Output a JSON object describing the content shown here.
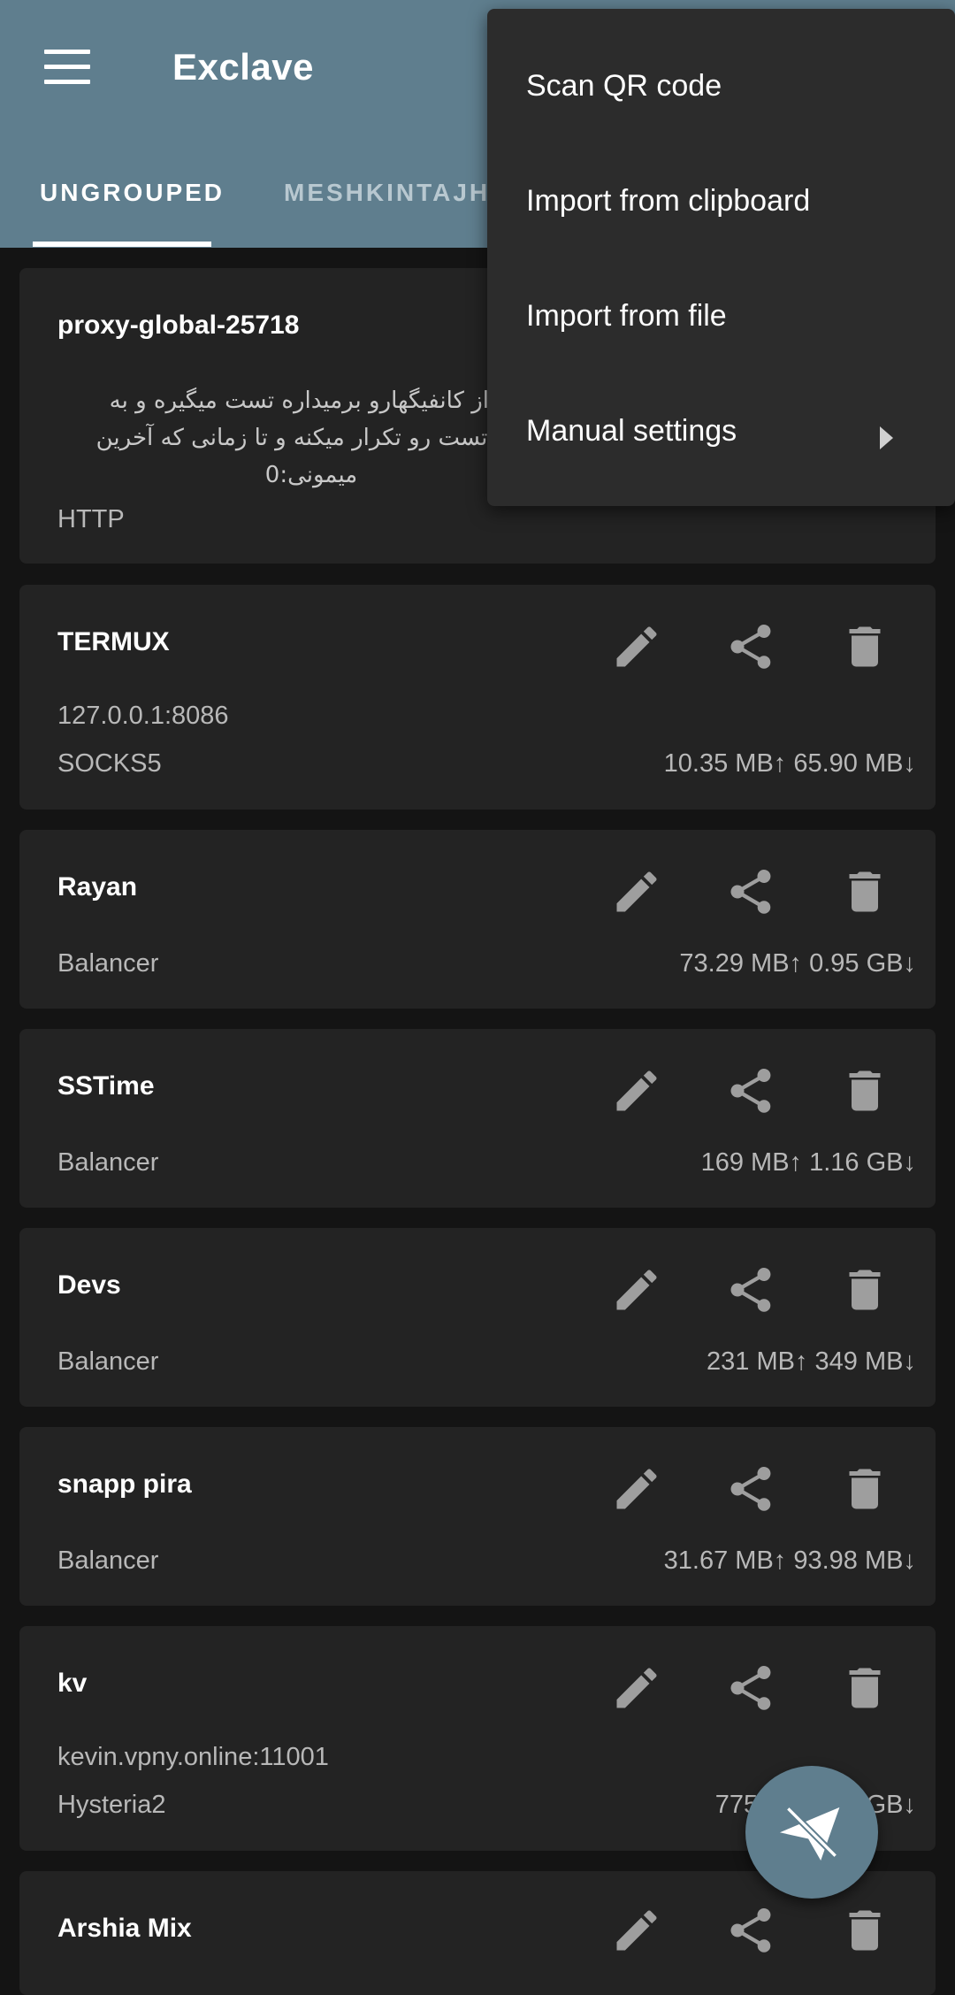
{
  "app": {
    "title": "Exclave"
  },
  "tabs": [
    {
      "label": "UNGROUPED",
      "active": true
    },
    {
      "label": "MESHKINTAJH",
      "active": false
    }
  ],
  "menu": {
    "items": [
      "Scan QR code",
      "Import from clipboard",
      "Import from file",
      "Manual settings"
    ]
  },
  "profiles": [
    {
      "name": "proxy-global-25718",
      "desc_lines": [
        "ن از کانفیگهارو برمیداره تست میگیره و به",
        "سه تست رو تکرار میکنه و تا زمانی که آخرین",
        "میمونی:0"
      ],
      "type": "HTTP"
    },
    {
      "name": "TERMUX",
      "address": "127.0.0.1:8086",
      "type": "SOCKS5",
      "traffic": "10.35 MB↑ 65.90 MB↓"
    },
    {
      "name": "Rayan",
      "type": "Balancer",
      "traffic": "73.29 MB↑ 0.95 GB↓"
    },
    {
      "name": "SSTime",
      "type": "Balancer",
      "traffic": "169 MB↑ 1.16 GB↓"
    },
    {
      "name": "Devs",
      "type": "Balancer",
      "traffic": "231 MB↑ 349 MB↓"
    },
    {
      "name": "snapp pira",
      "type": "Balancer",
      "traffic": "31.67 MB↑ 93.98 MB↓"
    },
    {
      "name": "kv",
      "address": "kevin.vpny.online:11001",
      "type": "Hysteria2",
      "traffic": "775 MB↑ 1.2 GB↓"
    },
    {
      "name": "Arshia Mix"
    }
  ],
  "icons": {
    "menu": "hamburger-icon",
    "edit": "pencil-icon",
    "share": "share-icon",
    "delete": "trash-icon",
    "submenu": "chevron-right-icon",
    "fab": "paper-plane-icon"
  },
  "colors": {
    "appbar": "#5f7e8e",
    "card": "#232323",
    "background": "#141414",
    "menu": "#2c2c2c",
    "icon": "#9e9e9e"
  }
}
